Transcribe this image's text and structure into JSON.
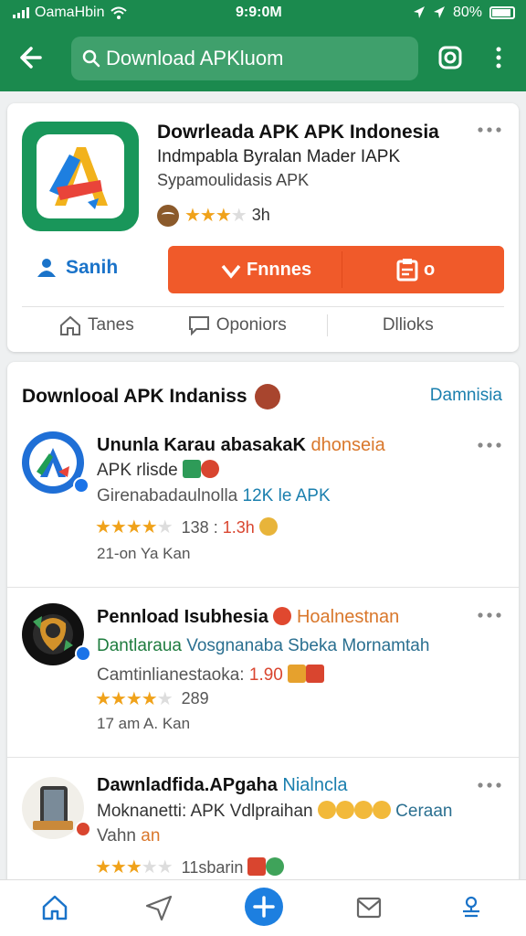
{
  "status_bar": {
    "carrier": "OamaHbin",
    "time": "9:9:0M",
    "battery": "80%"
  },
  "header": {
    "search_value": "Download APKluom"
  },
  "app": {
    "title": "Dowrleada APK APK Indonesia",
    "subtitle": "Indmpabla Byralan Mader IAPK",
    "developer": "Sypamoulidasis APK",
    "rating_count": "3h",
    "save_label": "Sanih",
    "install_label": "Fnnnes",
    "install_right_label": "o",
    "tabs": [
      "Tanes",
      "Oponiors",
      "Dllioks"
    ]
  },
  "list": {
    "heading": "Downlooal APK Indaniss",
    "link": "Damnisia",
    "items": [
      {
        "title": "Ununla Karau abasakaK",
        "title_accent": "dhonseia",
        "line2": "APK rlisde",
        "line3_prefix": "Girenabadaulnolla",
        "line3_accent": "12K le APK",
        "rating_text": "138 :",
        "rating_accent": "1.3h",
        "meta": "21-on Ya Kan"
      },
      {
        "title": "Pennload Isubhesia",
        "title_accent": "Hoalnestnan",
        "line2_prefix": "Dantlaraua",
        "line2_accent": "Vosgnanaba Sbeka Mornamtah",
        "line3_prefix": "Camtinlianestaoka:",
        "line3_accent": "1.90",
        "rating_text": "289",
        "meta": "17 am A. Kan"
      },
      {
        "title": "Dawnladfida.APgaha",
        "title_accent": "Nialncla",
        "line2": "Moknanetti: APK Vdlpraihan",
        "line2_accent": "Ceraan",
        "line3": "Vahn",
        "line3_accent": "an",
        "rating_text": "11sbarin"
      }
    ]
  },
  "colors": {
    "header_green": "#1b8a4e",
    "install_orange": "#f05a2a",
    "link_blue": "#1a7fae",
    "star_gold": "#f0a21a"
  },
  "icons": {
    "nav": [
      "home-icon",
      "send-icon",
      "add-icon",
      "mail-icon",
      "profile-icon"
    ]
  }
}
